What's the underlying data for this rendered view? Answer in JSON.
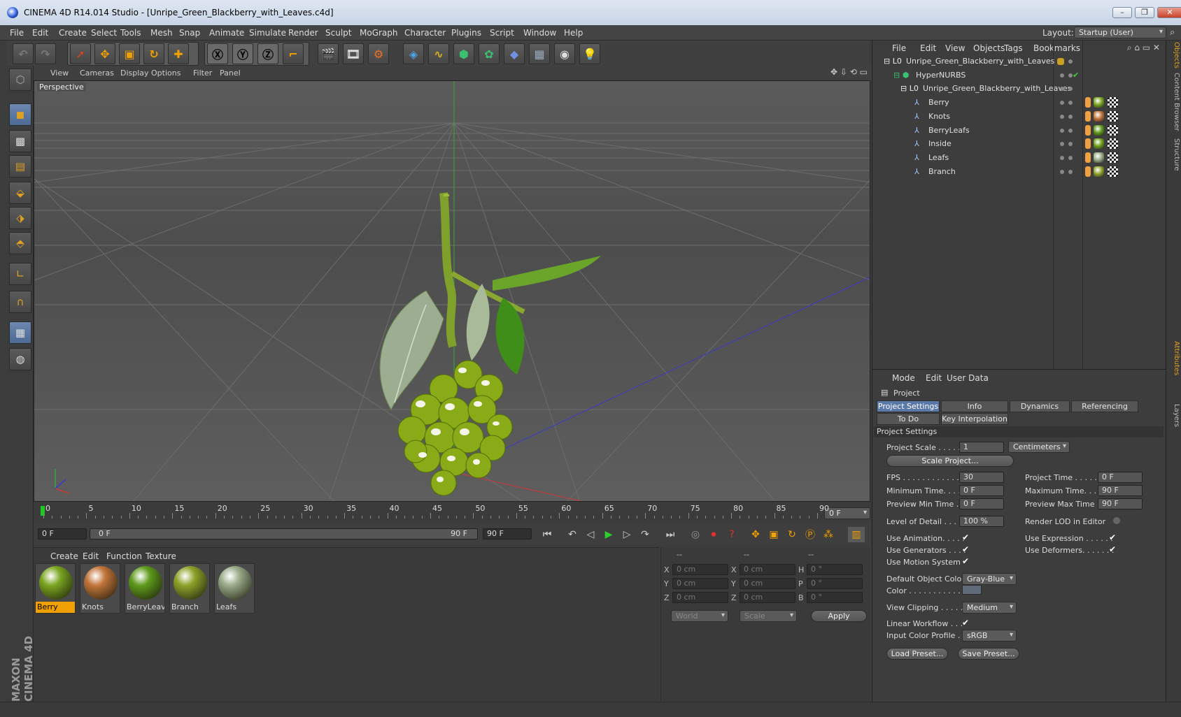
{
  "window": {
    "title": "CINEMA 4D R14.014 Studio - [Unripe_Green_Blackberry_with_Leaves.c4d]"
  },
  "menu": [
    "File",
    "Edit",
    "Create",
    "Select",
    "Tools",
    "Mesh",
    "Snap",
    "Animate",
    "Simulate",
    "Render",
    "Sculpt",
    "MoGraph",
    "Character",
    "Plugins",
    "Script",
    "Window",
    "Help"
  ],
  "layout": {
    "label": "Layout:",
    "value": "Startup (User)"
  },
  "viewport": {
    "menu": [
      "View",
      "Cameras",
      "Display",
      "Options",
      "Filter",
      "Panel"
    ],
    "label": "Perspective"
  },
  "timeline": {
    "ticks": [
      "0",
      "5",
      "10",
      "15",
      "20",
      "25",
      "30",
      "35",
      "40",
      "45",
      "50",
      "55",
      "60",
      "65",
      "70",
      "75",
      "80",
      "85",
      "90"
    ],
    "current": "0 F"
  },
  "playbar": {
    "start": "0 F",
    "range_start": "0 F",
    "range_end": "90 F",
    "end": "90 F"
  },
  "materials": {
    "menu": [
      "Create",
      "Edit",
      "Function",
      "Texture"
    ],
    "items": [
      {
        "name": "Berry",
        "selected": true,
        "color": "#7aa520"
      },
      {
        "name": "Knots",
        "selected": false,
        "color": "#c2743a"
      },
      {
        "name": "BerryLeave",
        "selected": false,
        "color": "#5e9a1c"
      },
      {
        "name": "Branch",
        "selected": false,
        "color": "#8da22a"
      },
      {
        "name": "Leafs",
        "selected": false,
        "color": "#9aab8a"
      }
    ]
  },
  "coords": {
    "headers": [
      "--",
      "--",
      "--"
    ],
    "rows": [
      {
        "a": "X",
        "av": "0 cm",
        "b": "X",
        "bv": "0 cm",
        "c": "H",
        "cv": "0 °"
      },
      {
        "a": "Y",
        "av": "0 cm",
        "b": "Y",
        "bv": "0 cm",
        "c": "P",
        "cv": "0 °"
      },
      {
        "a": "Z",
        "av": "0 cm",
        "b": "Z",
        "bv": "0 cm",
        "c": "B",
        "cv": "0 °"
      }
    ],
    "space": "World",
    "mode": "Scale",
    "apply": "Apply"
  },
  "objects": {
    "menu": [
      "File",
      "Edit",
      "View",
      "Objects",
      "Tags",
      "Bookmarks"
    ],
    "rows": [
      {
        "name": "Unripe_Green_Blackberry_with_Leaves"
      },
      {
        "name": "HyperNURBS"
      },
      {
        "name": "Unripe_Green_Blackberry_with_Leaves"
      },
      {
        "name": "Berry",
        "tag": "#7aa520"
      },
      {
        "name": "Knots",
        "tag": "#c2743a"
      },
      {
        "name": "BerryLeafs",
        "tag": "#5e9a1c"
      },
      {
        "name": "Inside",
        "tag": "#6fa01c"
      },
      {
        "name": "Leafs",
        "tag": "#9aab8a"
      },
      {
        "name": "Branch",
        "tag": "#8da22a"
      }
    ]
  },
  "attributes": {
    "menu": [
      "Mode",
      "Edit",
      "User Data"
    ],
    "object": "Project",
    "tabs": [
      "Project Settings",
      "Info",
      "Dynamics",
      "Referencing"
    ],
    "tabs2": [
      "To Do",
      "Key Interpolation"
    ],
    "section": "Project Settings",
    "project_scale": {
      "label": "Project Scale . . . . . .",
      "value": "1",
      "unit": "Centimeters"
    },
    "scale_btn": "Scale Project...",
    "fps": {
      "label": "FPS . . . . . . . . . . . . . .",
      "value": "30"
    },
    "project_time": {
      "label": "Project Time . . . . . . . .",
      "value": "0 F"
    },
    "min_time": {
      "label": "Minimum Time. . . . .",
      "value": "0 F"
    },
    "max_time": {
      "label": "Maximum Time. . . . . .",
      "value": "90 F"
    },
    "prev_min": {
      "label": "Preview Min Time . . .",
      "value": "0 F"
    },
    "prev_max": {
      "label": "Preview Max Time . . .",
      "value": "90 F"
    },
    "lod": {
      "label": "Level of Detail . . . . .",
      "value": "100 %"
    },
    "render_lod": "Render LOD in Editor",
    "use_anim": "Use Animation. . . . .",
    "use_expr": "Use Expression . . . . . .",
    "use_gen": "Use Generators . . . .",
    "use_def": "Use Deformers. . . . . . .",
    "use_motion": "Use Motion System",
    "def_color": {
      "label": "Default Object Color",
      "value": "Gray-Blue"
    },
    "color": "Color . . . . . . . . . . .",
    "view_clip": {
      "label": "View Clipping . . . . .",
      "value": "Medium"
    },
    "linear": "Linear Workflow . . .",
    "icp": {
      "label": "Input Color Profile . .",
      "value": "sRGB"
    },
    "load": "Load Preset...",
    "save": "Save Preset..."
  },
  "side_tabs": [
    "Objects",
    "Content Browser",
    "Structure",
    "Attributes",
    "Layers"
  ],
  "brand": "MAXON CINEMA 4D"
}
